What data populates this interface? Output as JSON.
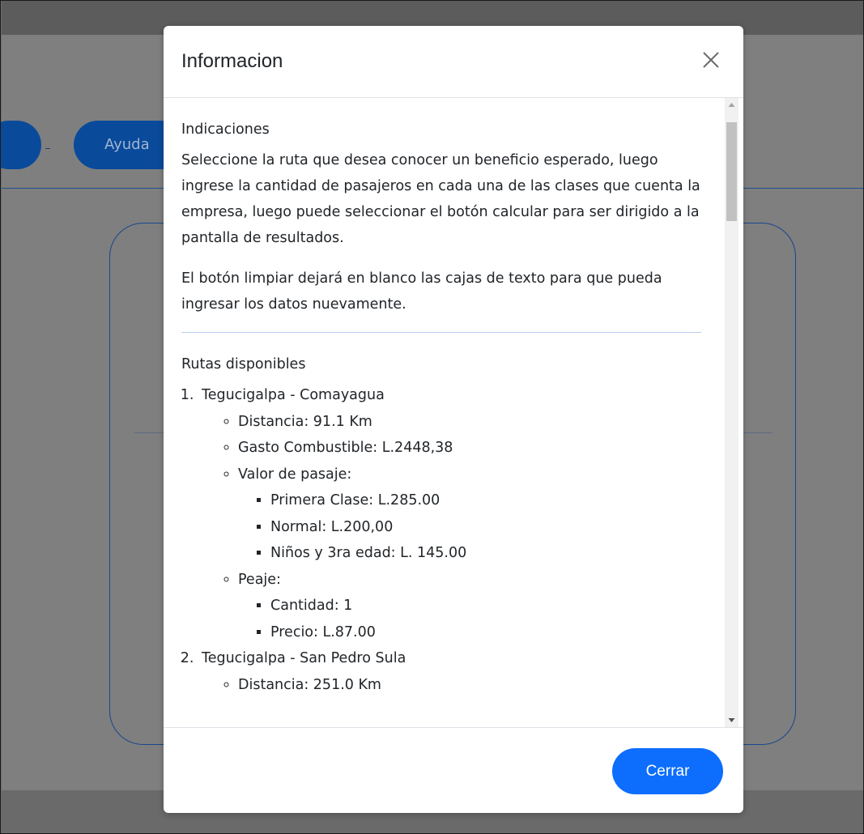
{
  "background": {
    "ayuda_label": "Ayuda"
  },
  "modal": {
    "title": "Informacion",
    "close_icon": "close-icon",
    "indicaciones": {
      "heading": "Indicaciones",
      "paragraph1": "Seleccione la ruta que desea conocer un beneficio esperado, luego ingrese la cantidad de pasajeros en cada una de las clases que cuenta la empresa, luego puede seleccionar el botón calcular para ser dirigido a la pantalla de resultados.",
      "paragraph2": "El botón limpiar dejará en blanco las cajas de texto para que pueda ingresar los datos nuevamente."
    },
    "rutas": {
      "heading": "Rutas disponibles",
      "routes": [
        {
          "name": "Tegucigalpa - Comayagua",
          "distancia": "Distancia: 91.1 Km",
          "gasto": "Gasto Combustible: L.2448,38",
          "valor_label": "Valor de pasaje:",
          "valores": [
            "Primera Clase: L.285.00",
            "Normal: L.200,00",
            "Niños y 3ra edad: L. 145.00"
          ],
          "peaje_label": "Peaje:",
          "peaje": [
            "Cantidad: 1",
            "Precio: L.87.00"
          ]
        },
        {
          "name": "Tegucigalpa - San Pedro Sula",
          "distancia": "Distancia: 251.0 Km"
        }
      ]
    },
    "footer": {
      "close_label": "Cerrar"
    }
  },
  "colors": {
    "primary": "#0d6efd",
    "overlay": "#7f7f7f",
    "dim_button": "#0a4a9a"
  }
}
